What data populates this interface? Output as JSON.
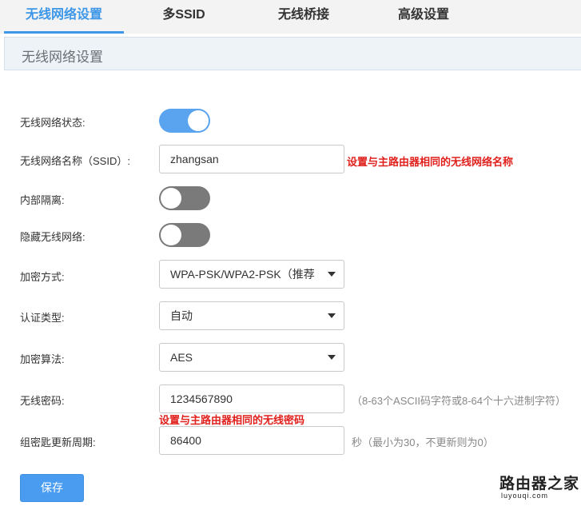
{
  "tabs": [
    {
      "label": "无线网络设置",
      "active": true
    },
    {
      "label": "多SSID",
      "active": false
    },
    {
      "label": "无线桥接",
      "active": false
    },
    {
      "label": "高级设置",
      "active": false
    }
  ],
  "section": {
    "title": "无线网络设置"
  },
  "form": {
    "wireless_status": {
      "label": "无线网络状态:",
      "enabled": true
    },
    "ssid": {
      "label": "无线网络名称（SSID）:",
      "value": "zhangsan",
      "hint": "设置与主路由器相同的无线网络名称"
    },
    "isolation": {
      "label": "内部隔离:",
      "enabled": false
    },
    "hide_ssid": {
      "label": "隐藏无线网络:",
      "enabled": false
    },
    "encryption_mode": {
      "label": "加密方式:",
      "value": "WPA-PSK/WPA2-PSK（推荐"
    },
    "auth_type": {
      "label": "认证类型:",
      "value": "自动"
    },
    "encryption_algorithm": {
      "label": "加密算法:",
      "value": "AES"
    },
    "password": {
      "label": "无线密码:",
      "value": "1234567890",
      "note": "（8-63个ASCII码字符或8-64个十六进制字符）",
      "hint": "设置与主路由器相同的无线密码"
    },
    "group_key_period": {
      "label": "组密匙更新周期:",
      "value": "86400",
      "note": "秒（最小为30，不更新则为0）"
    }
  },
  "buttons": {
    "save": "保存"
  },
  "watermark": {
    "text": "路由器之家",
    "sub": "luyouqi.com"
  },
  "colors": {
    "accent": "#3d97e8",
    "toggle_on": "#5aa3ee",
    "toggle_off": "#7a7a7a",
    "hint_red": "#e0201c"
  }
}
